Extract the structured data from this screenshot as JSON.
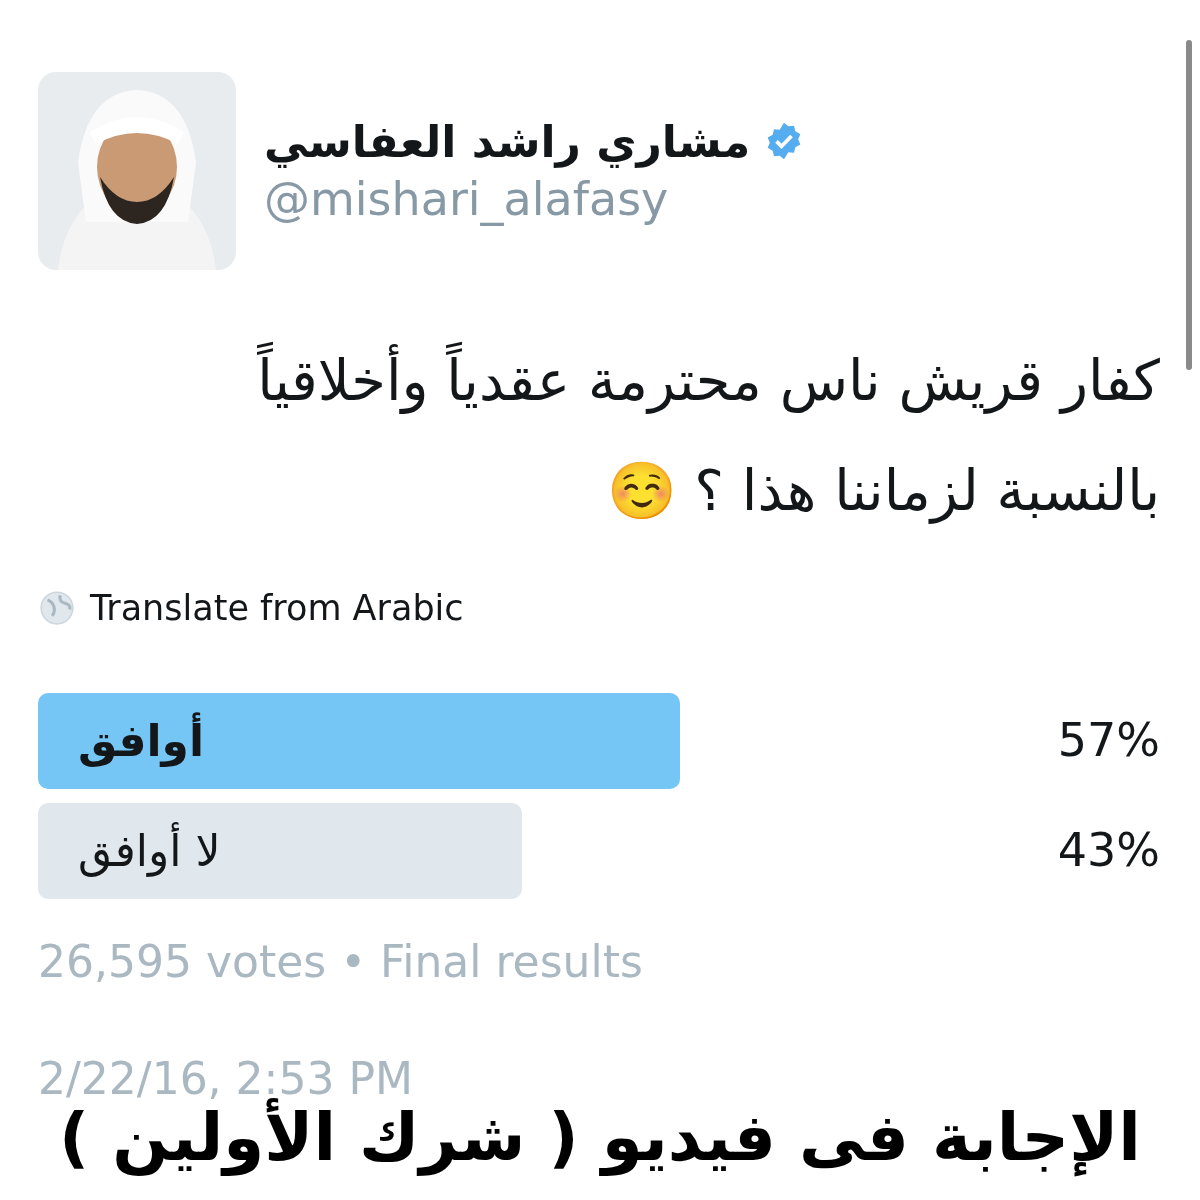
{
  "author": {
    "name": "مشاري راشد العفاسي",
    "verified": true,
    "handle": "@mishari_alafasy"
  },
  "tweet": {
    "lines": [
      "كفار قريش ناس محترمة عقدياً وأخلاقياً",
      "بالنسبة لزماننا هذا ؟ ☺️"
    ]
  },
  "translate": "Translate from Arabic",
  "poll": {
    "options": [
      {
        "label": "أوافق",
        "percent": "57%",
        "winner": true
      },
      {
        "label": "لا أوافق",
        "percent": "43%",
        "winner": false
      }
    ],
    "summary": "26,595 votes • Final results"
  },
  "timestamp": "2/22/16, 2:53 PM",
  "caption": "الإجابة فى فيديو ( شرك الأولين )"
}
